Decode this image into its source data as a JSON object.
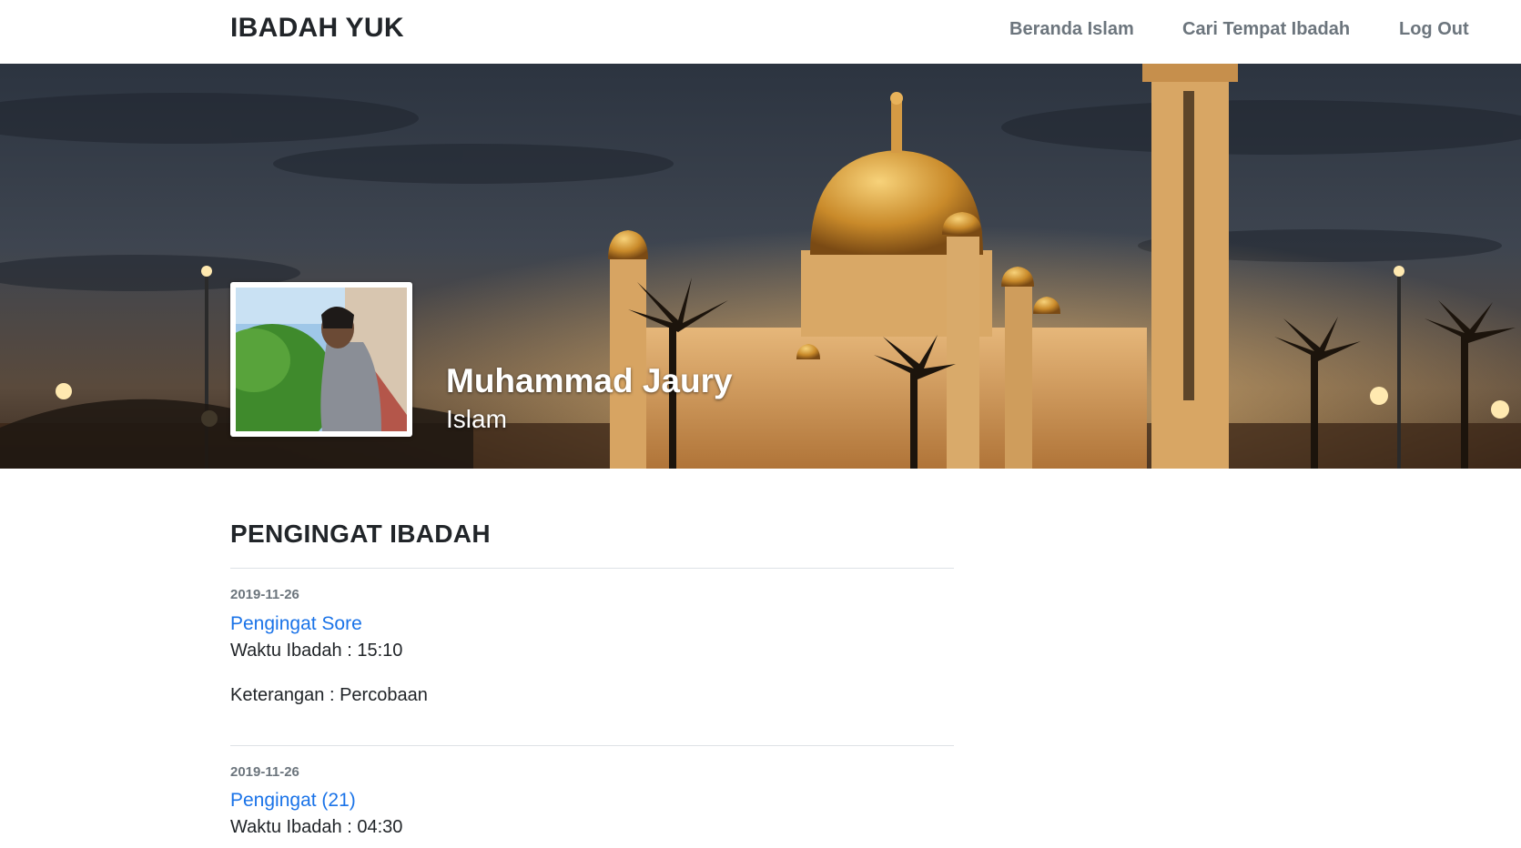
{
  "navbar": {
    "brand": "IBADAH YUK",
    "links": [
      {
        "label": "Beranda Islam"
      },
      {
        "label": "Cari Tempat Ibadah"
      },
      {
        "label": "Log Out"
      }
    ]
  },
  "profile": {
    "name": "Muhammad Jaury",
    "religion": "Islam"
  },
  "reminders": {
    "title": "PENGINGAT IBADAH",
    "items": [
      {
        "date": "2019-11-26",
        "title": "Pengingat Sore",
        "time_line": "Waktu Ibadah : 15:10",
        "note_line": "Keterangan : Percobaan"
      },
      {
        "date": "2019-11-26",
        "title": "Pengingat (21)",
        "time_line": "Waktu Ibadah : 04:30"
      }
    ]
  }
}
